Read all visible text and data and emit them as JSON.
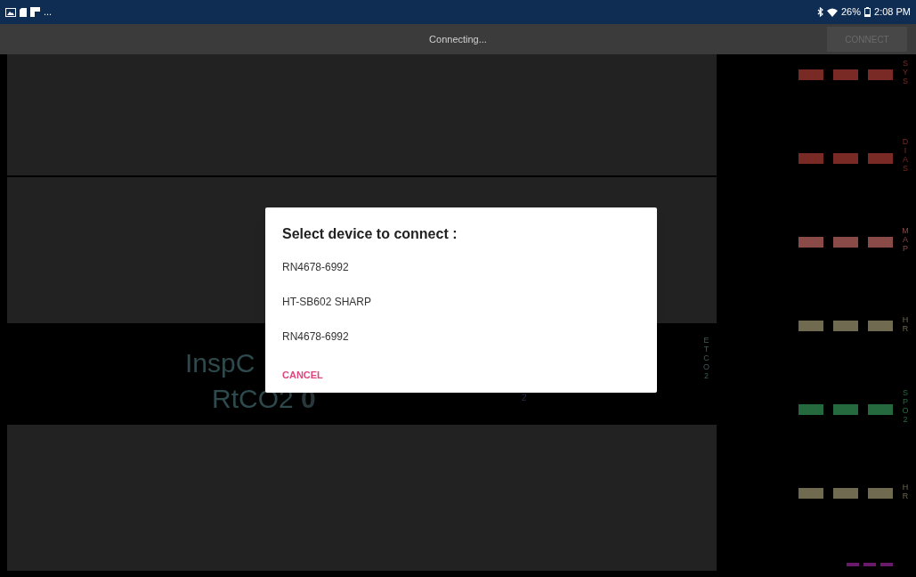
{
  "status_bar": {
    "overflow": "...",
    "battery": "26%",
    "time": "2:08 PM"
  },
  "toolbar": {
    "title": "Connecting...",
    "connect_button": {
      "label": "CONNECT",
      "disabled": true
    }
  },
  "monitor": {
    "insp_label": "InspC",
    "rt_label": "RtCO2",
    "rt_value": "0",
    "value_a_unit": "2",
    "etco2_label": "ETCO2"
  },
  "sidebar": [
    {
      "label": "SYS",
      "color": "#7a2a24",
      "kind": "bars"
    },
    {
      "label": "DIAS",
      "color": "#7a2a24",
      "kind": "bars"
    },
    {
      "label": "MAP",
      "color": "#8a4a48",
      "kind": "bars"
    },
    {
      "label": "HR",
      "color": "#6f6a50",
      "kind": "bars"
    },
    {
      "label": "SPO2",
      "color": "#25693f",
      "kind": "bars"
    },
    {
      "label": "HR",
      "color": "#6f6a50",
      "kind": "bars"
    },
    {
      "color": "#6a1a6a",
      "kind": "small"
    }
  ],
  "dialog": {
    "title": "Select device to connect :",
    "devices": [
      "RN4678-6992",
      "HT-SB602 SHARP",
      "RN4678-6992"
    ],
    "cancel": "CANCEL"
  }
}
